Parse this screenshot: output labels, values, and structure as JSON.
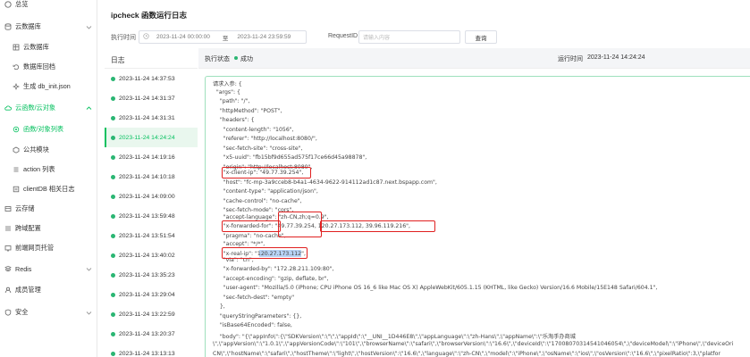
{
  "sidebar": {
    "top_item": "总览",
    "cloud_db": {
      "label": "云数据库",
      "children": [
        "云数据库",
        "数据库回档",
        "生成 db_init.json"
      ]
    },
    "cloud_func": {
      "label": "云函数/云对象",
      "children": [
        "函数/对象列表",
        "公共模块",
        "action 列表",
        "clientDB 相关日志"
      ]
    },
    "others": [
      {
        "label": "云存储",
        "icon": "cloud-storage-icon"
      },
      {
        "label": "跨域配置",
        "icon": "cross-domain-icon"
      },
      {
        "label": "前端网页托管",
        "icon": "web-hosting-icon"
      },
      {
        "label": "Redis",
        "icon": "redis-icon"
      },
      {
        "label": "成员管理",
        "icon": "members-icon"
      },
      {
        "label": "安全",
        "icon": "shield-icon"
      }
    ]
  },
  "header": {
    "title": "ipcheck 函数运行日志",
    "exec_time_label": "执行时间",
    "date_start": "2023-11-24 00:00:00",
    "date_to": "至",
    "date_end": "2023-11-24 23:59:59",
    "request_id_label": "RequestID",
    "request_id_placeholder": "请输入内容",
    "query_button": "查询"
  },
  "log_list": {
    "heading": "日志",
    "items": [
      "2023-11-24 14:37:53",
      "2023-11-24 14:31:37",
      "2023-11-24 14:31:31",
      "2023-11-24 14:24:24",
      "2023-11-24 14:19:16",
      "2023-11-24 14:10:18",
      "2023-11-24 14:09:00",
      "2023-11-24 13:59:48",
      "2023-11-24 13:51:54",
      "2023-11-24 13:40:02",
      "2023-11-24 13:35:23",
      "2023-11-24 13:29:04",
      "2023-11-24 13:22:59",
      "2023-11-24 13:20:37",
      "2023-11-24 13:13:13"
    ],
    "selected": "2023-11-24 14:24:24"
  },
  "detail": {
    "status_label": "执行状态",
    "status_value": "成功",
    "run_time_label": "运行时间",
    "run_time_value": "2023-11-24 14:24:24",
    "code_lines": [
      "请求入参: {",
      "  \"args\": {",
      "    \"path\": \"/\",",
      "    \"httpMethod\": \"POST\",",
      "    \"headers\": {",
      "      \"content-length\": \"1056\",",
      "      \"referer\": \"http://localhost:8080/\",",
      "      \"sec-fetch-site\": \"cross-site\",",
      "      \"x5-uuid\": \"fb15bf9d655ad575f17ce66d45a98878\",",
      "      \"origin\": \"http://localhost:8080\",",
      "      \"x-client-ip\": \"49.77.39.254\",",
      "      \"host\": \"fc-mp-3a9cceb8-b4a1-4634-9622-914112ad1c87.next.bspapp.com\",",
      "      \"content-type\": \"application/json\",",
      "      \"cache-control\": \"no-cache\",",
      "      \"sec-fetch-mode\": \"cors\",",
      "      \"accept-language\": \"zh-CN,zh;q=0.9\",",
      "      \"x-forwarded-for\": \"49.77.39.254, 120.27.173.112, 39.96.119.216\",",
      "      \"pragma\": \"no-cache\",",
      "      \"accept\": \"*/*\",",
      "      \"x-real-ip\": \"120.27.173.112\",",
      "      \"via\": \"cn\",",
      "      \"x-forwarded-by\": \"172.28.211.109:80\",",
      "      \"accept-encoding\": \"gzip, deflate, br\",",
      "      \"user-agent\": \"Mozilla/5.0 (iPhone; CPU iPhone OS 16_6 like Mac OS X) AppleWebKit/605.1.15 (KHTML, like Gecko) Version/16.6 Mobile/15E148 Safari/604.1\",",
      "      \"sec-fetch-dest\": \"empty\"",
      "    },",
      "    \"queryStringParameters\": {},",
      "    \"isBase64Encoded\": false,",
      "    \"body\": \"{\\\"appInfo\\\":{\\\"SDKVersion\\\":\\\"\\\",\\\"appId\\\":\\\"__UNI__1D446E8\\\",\\\"appLanguage\\\":\\\"zh-Hans\\\",\\\"appName\\\":\\\"乐淘手办商城",
      "\\\",\\\"appVersion\\\":\\\"1.0.1\\\",\\\"appVersionCode\\\":\\\"101\\\",\\\"browserName\\\":\\\"safari\\\",\\\"browserVersion\\\":\\\"16.6\\\",\\\"deviceId\\\":\\\"17008070314541046054\\\",\\\"deviceModel\\\":\\\"iPhone\\\",\\\"deviceOri",
      "CN\\\",\\\"hostName\\\":\\\"safari\\\",\\\"hostTheme\\\":\\\"light\\\",\\\"hostVersion\\\":\\\"16.6\\\",\\\"language\\\":\\\"zh-CN\\\",\\\"model\\\":\\\"iPhone\\\",\\\"osName\\\":\\\"ios\\\",\\\"osVersion\\\":\\\"16.6\\\",\\\"pixelRatio\\\":3,\\\"platfor"
    ]
  }
}
